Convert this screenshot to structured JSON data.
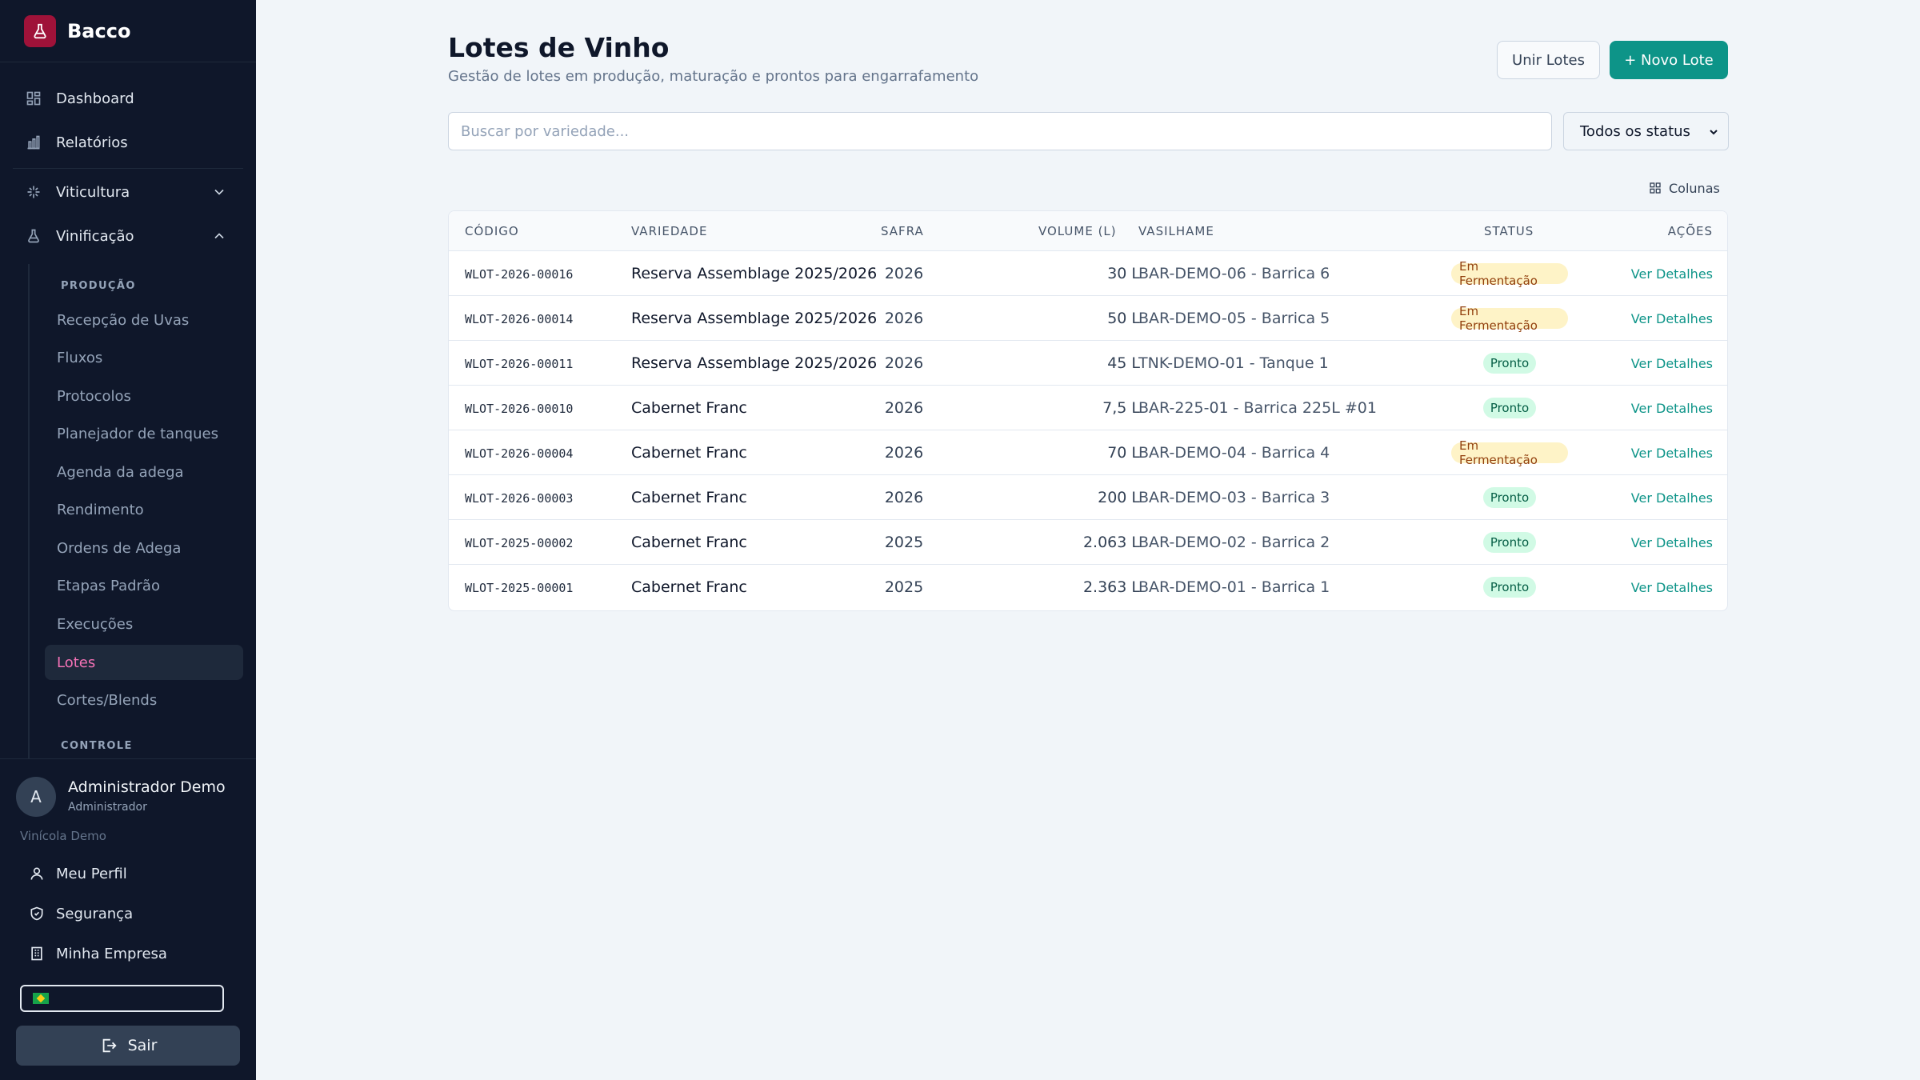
{
  "brand": {
    "name": "Bacco"
  },
  "sidebar": {
    "top_items": [
      {
        "label": "Dashboard",
        "icon": "dashboard-icon"
      },
      {
        "label": "Relatórios",
        "icon": "bar-chart-icon"
      }
    ],
    "groups": [
      {
        "label": "Viticultura",
        "icon": "sparkle-icon",
        "expanded": false
      },
      {
        "label": "Vinificação",
        "icon": "flask-icon",
        "expanded": true
      }
    ],
    "section_producao": "PRODUÇÃO",
    "producao_items": [
      "Recepção de Uvas",
      "Fluxos",
      "Protocolos",
      "Planejador de tanques",
      "Agenda da adega",
      "Rendimento",
      "Ordens de Adega",
      "Etapas Padrão",
      "Execuções",
      "Lotes",
      "Cortes/Blends"
    ],
    "active_item": "Lotes",
    "section_controle": "CONTROLE"
  },
  "user": {
    "initial": "A",
    "name": "Administrador Demo",
    "role": "Administrador",
    "org": "Vinícola Demo",
    "menu": {
      "profile": "Meu Perfil",
      "security": "Segurança",
      "company": "Minha Empresa"
    },
    "language_flag": "brazil-flag",
    "logout": "Sair"
  },
  "page": {
    "title": "Lotes de Vinho",
    "subtitle": "Gestão de lotes em produção, maturação e prontos para engarrafamento",
    "merge_button": "Unir Lotes",
    "new_button": "+ Novo Lote",
    "search_placeholder": "Buscar por variedade...",
    "status_filter": "Todos os status",
    "columns_button": "Colunas"
  },
  "table": {
    "headers": {
      "code": "CÓDIGO",
      "variety": "VARIEDADE",
      "safra": "SAFRA",
      "volume": "VOLUME (L)",
      "vessel": "VASILHAME",
      "status": "STATUS",
      "actions": "AÇÕES"
    },
    "rows": [
      {
        "code": "WLOT-2026-00016",
        "variety": "Reserva Assemblage 2025/2026",
        "safra": "2026",
        "volume": "30 L",
        "vessel": "BAR-DEMO-06 - Barrica 6",
        "status": "Em Fermentação",
        "action": "Ver Detalhes"
      },
      {
        "code": "WLOT-2026-00014",
        "variety": "Reserva Assemblage 2025/2026",
        "safra": "2026",
        "volume": "50 L",
        "vessel": "BAR-DEMO-05 - Barrica 5",
        "status": "Em Fermentação",
        "action": "Ver Detalhes"
      },
      {
        "code": "WLOT-2026-00011",
        "variety": "Reserva Assemblage 2025/2026",
        "safra": "2026",
        "volume": "45 L",
        "vessel": "TNK-DEMO-01 - Tanque 1",
        "status": "Pronto",
        "action": "Ver Detalhes"
      },
      {
        "code": "WLOT-2026-00010",
        "variety": "Cabernet Franc",
        "safra": "2026",
        "volume": "7,5 L",
        "vessel": "BAR-225-01 - Barrica 225L #01",
        "status": "Pronto",
        "action": "Ver Detalhes"
      },
      {
        "code": "WLOT-2026-00004",
        "variety": "Cabernet Franc",
        "safra": "2026",
        "volume": "70 L",
        "vessel": "BAR-DEMO-04 - Barrica 4",
        "status": "Em Fermentação",
        "action": "Ver Detalhes"
      },
      {
        "code": "WLOT-2026-00003",
        "variety": "Cabernet Franc",
        "safra": "2026",
        "volume": "200 L",
        "vessel": "BAR-DEMO-03 - Barrica 3",
        "status": "Pronto",
        "action": "Ver Detalhes"
      },
      {
        "code": "WLOT-2025-00002",
        "variety": "Cabernet Franc",
        "safra": "2025",
        "volume": "2.063 L",
        "vessel": "BAR-DEMO-02 - Barrica 2",
        "status": "Pronto",
        "action": "Ver Detalhes"
      },
      {
        "code": "WLOT-2025-00001",
        "variety": "Cabernet Franc",
        "safra": "2025",
        "volume": "2.363 L",
        "vessel": "BAR-DEMO-01 - Barrica 1",
        "status": "Pronto",
        "action": "Ver Detalhes"
      }
    ]
  },
  "colors": {
    "accent": "#0d9488",
    "active_nav": "#f472b6",
    "sidebar_bg": "#0f172a",
    "brand_logo": "#9f1239",
    "status_fermentation_bg": "#fef3c7",
    "status_ready_bg": "#d1fae5"
  }
}
